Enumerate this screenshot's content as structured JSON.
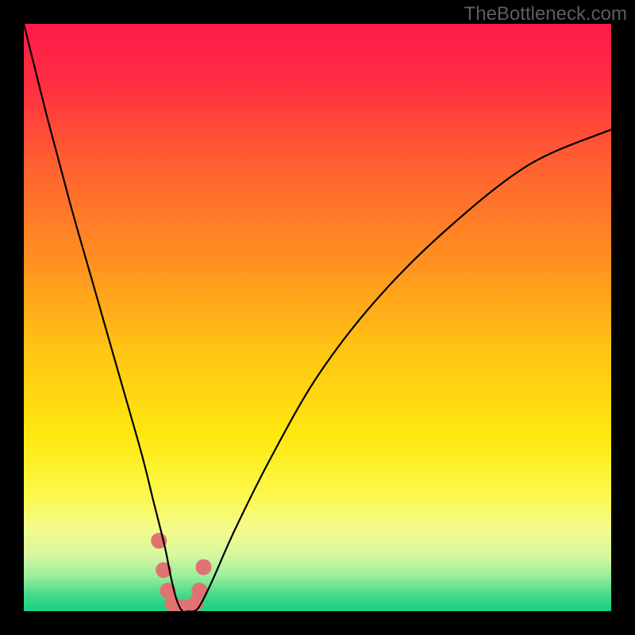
{
  "watermark": "TheBottleneck.com",
  "gradient_stops": [
    {
      "offset": 0.0,
      "color": "#ff1a4b"
    },
    {
      "offset": 0.1,
      "color": "#ff2e41"
    },
    {
      "offset": 0.25,
      "color": "#ff6430"
    },
    {
      "offset": 0.4,
      "color": "#ff8f20"
    },
    {
      "offset": 0.55,
      "color": "#ffc314"
    },
    {
      "offset": 0.7,
      "color": "#ffe80e"
    },
    {
      "offset": 0.8,
      "color": "#fcf84a"
    },
    {
      "offset": 0.86,
      "color": "#f4fb8c"
    },
    {
      "offset": 0.905,
      "color": "#d7f7a0"
    },
    {
      "offset": 0.94,
      "color": "#9bee9c"
    },
    {
      "offset": 0.975,
      "color": "#3fd989"
    },
    {
      "offset": 1.0,
      "color": "#18cf84"
    }
  ],
  "chart_data": {
    "type": "line",
    "title": "",
    "xlabel": "",
    "ylabel": "",
    "xlim": [
      0,
      100
    ],
    "ylim": [
      0,
      100
    ],
    "series": [
      {
        "name": "bottleneck-curve",
        "x": [
          0,
          4,
          8,
          12,
          16,
          20,
          22,
          24,
          25,
          26,
          27,
          28,
          29,
          30,
          32,
          36,
          42,
          50,
          60,
          72,
          86,
          100
        ],
        "y": [
          100,
          84,
          69,
          55,
          41,
          27,
          19,
          11,
          6,
          2,
          0,
          0,
          0,
          1,
          5,
          14,
          26,
          40,
          53,
          65,
          76,
          82
        ]
      }
    ],
    "markers": {
      "name": "highlight-cluster",
      "points_xy": [
        [
          23.0,
          12.0
        ],
        [
          23.8,
          7.0
        ],
        [
          24.5,
          3.5
        ],
        [
          25.3,
          1.3
        ],
        [
          26.5,
          0.7
        ],
        [
          28.0,
          0.7
        ],
        [
          29.2,
          1.3
        ],
        [
          29.9,
          3.5
        ],
        [
          30.6,
          7.5
        ]
      ],
      "color": "#e27272",
      "radius_px": 10
    }
  }
}
